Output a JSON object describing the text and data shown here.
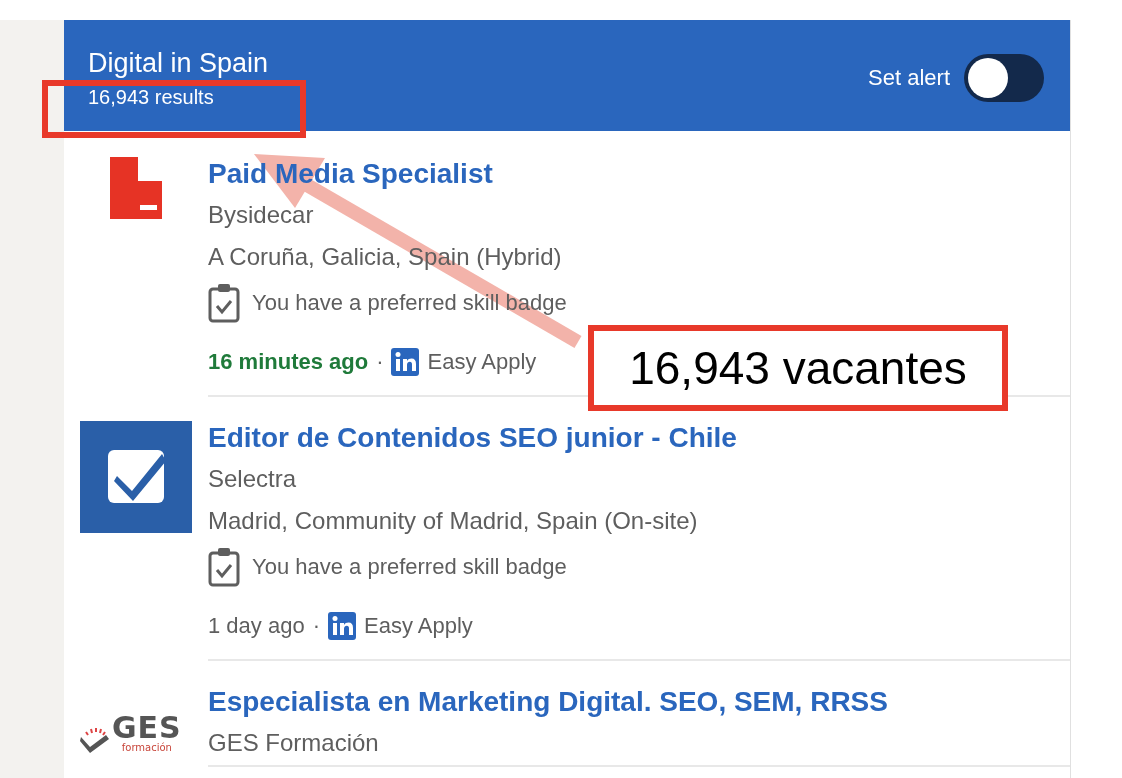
{
  "header": {
    "title": "Digital in Spain",
    "results": "16,943 results",
    "alert": {
      "label": "Set alert",
      "on": false
    }
  },
  "jobs": [
    {
      "title": "Paid Media Specialist",
      "company": "Bysidecar",
      "location": "A Coruña, Galicia, Spain (Hybrid)",
      "badge": "You have a preferred skill badge",
      "posted": "16 minutes ago",
      "recent": true,
      "separator": "·",
      "apply": "Easy Apply",
      "logo": {
        "kind": "block"
      }
    },
    {
      "title": "Editor de Contenidos SEO junior - Chile",
      "company": "Selectra",
      "location": "Madrid, Community of Madrid, Spain (On-site)",
      "badge": "You have a preferred skill badge",
      "posted": "1 day ago",
      "recent": false,
      "separator": "·",
      "apply": "Easy Apply",
      "logo": {
        "kind": "check"
      }
    },
    {
      "title": "Especialista en Marketing Digital. SEO, SEM, RRSS",
      "company": "GES Formación",
      "logo": {
        "kind": "wordmark",
        "text": "GES",
        "subtext": "formación"
      }
    }
  ],
  "annotation": {
    "callout": "16,943 vacantes"
  }
}
